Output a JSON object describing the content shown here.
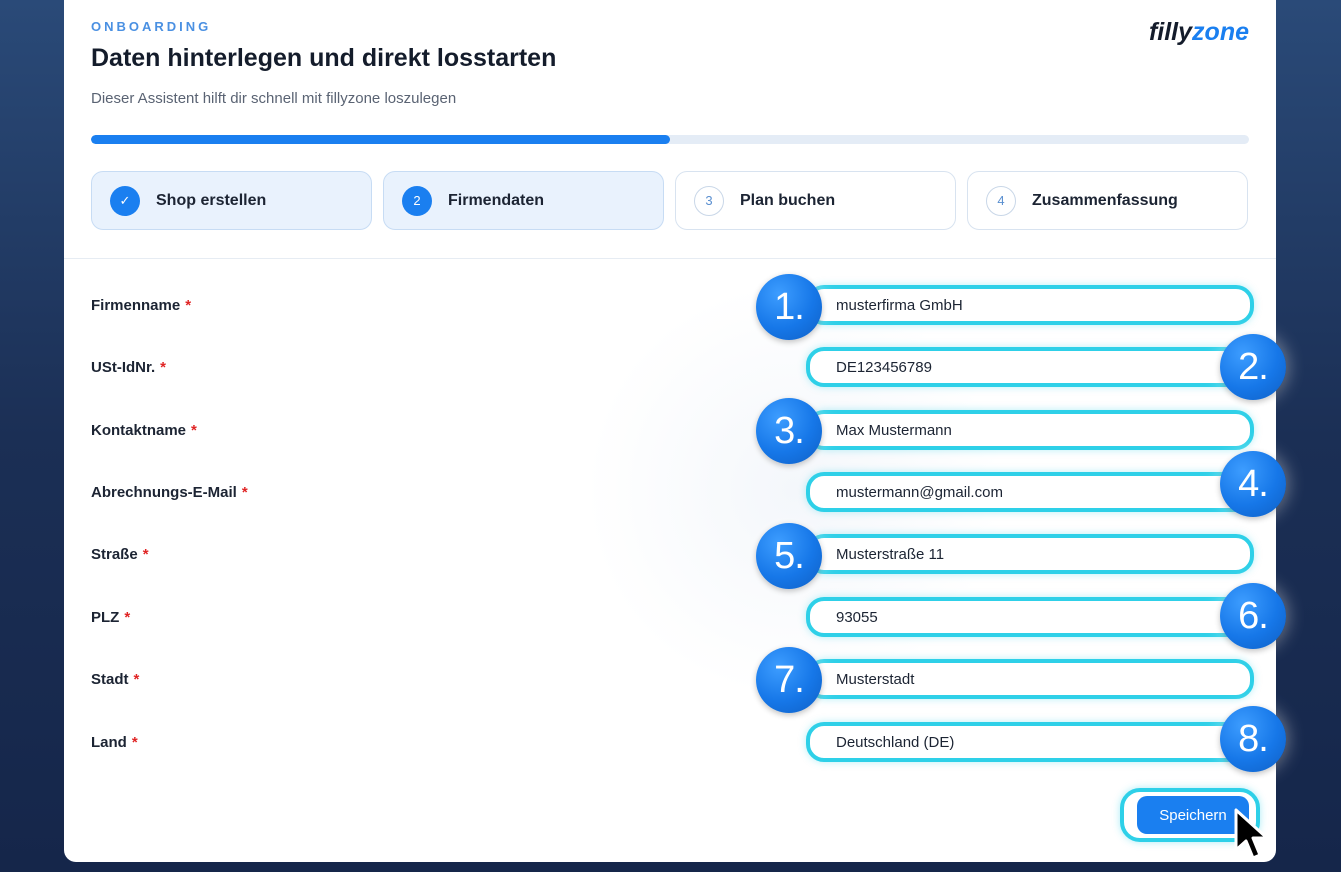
{
  "header": {
    "eyebrow": "ONBOARDING",
    "title": "Daten hinterlegen und direkt losstarten",
    "subtitle": "Dieser Assistent hilft dir schnell mit fillyzone loszulegen",
    "logo_part1": "filly",
    "logo_part2": "zone",
    "progress_percent": 50
  },
  "steps": [
    {
      "badge": "✓",
      "label": "Shop erstellen",
      "state": "done"
    },
    {
      "badge": "2",
      "label": "Firmendaten",
      "state": "active"
    },
    {
      "badge": "3",
      "label": "Plan buchen",
      "state": "todo"
    },
    {
      "badge": "4",
      "label": "Zusammenfassung",
      "state": "todo"
    }
  ],
  "form": {
    "required_mark": "*",
    "fields": [
      {
        "label": "Firmenname",
        "value": "musterfirma GmbH",
        "marker": "1."
      },
      {
        "label": "USt-IdNr.",
        "value": "DE123456789",
        "marker": "2."
      },
      {
        "label": "Kontaktname",
        "value": "Max Mustermann",
        "marker": "3."
      },
      {
        "label": "Abrechnungs-E-Mail",
        "value": "mustermann@gmail.com",
        "marker": "4."
      },
      {
        "label": "Straße",
        "value": "Musterstraße 11",
        "marker": "5."
      },
      {
        "label": "PLZ",
        "value": "93055",
        "marker": "6."
      },
      {
        "label": "Stadt",
        "value": "Musterstadt",
        "marker": "7."
      },
      {
        "label": "Land",
        "value": "Deutschland (DE)",
        "marker": "8."
      }
    ],
    "save_label": "Speichern"
  },
  "colors": {
    "accent": "#1a7ff0",
    "highlight": "#2ed0e8",
    "required": "#e02424"
  }
}
